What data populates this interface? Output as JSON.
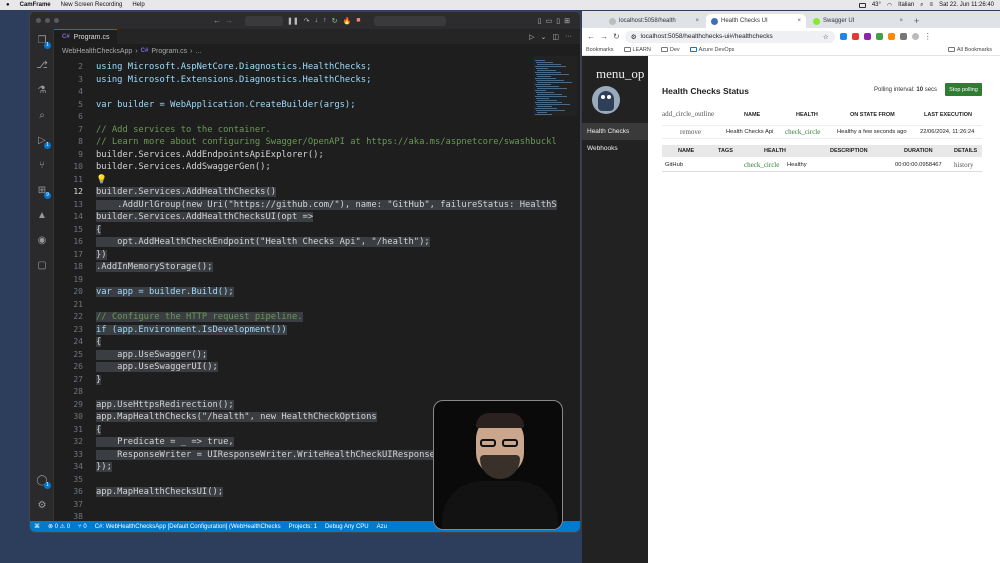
{
  "menubar": {
    "app": "CamFrame",
    "items": [
      "New Screen Recording",
      "Help"
    ],
    "temp": "43°",
    "input": "Italian",
    "datetime": "Sat 22. Jun 11:26:40"
  },
  "vscode": {
    "tab": {
      "label": "Program.cs",
      "badge": "C#"
    },
    "breadcrumb": [
      "WebHealthChecksApp",
      "Program.cs",
      "..."
    ],
    "code_lines": [
      {
        "n": "2",
        "text": "using Microsoft.AspNetCore.Diagnostics.HealthChecks;",
        "sel": false
      },
      {
        "n": "3",
        "text": "using Microsoft.Extensions.Diagnostics.HealthChecks;",
        "sel": false
      },
      {
        "n": "4",
        "text": "",
        "sel": false
      },
      {
        "n": "5",
        "text": "var builder = WebApplication.CreateBuilder(args);",
        "sel": false
      },
      {
        "n": "6",
        "text": "",
        "sel": false
      },
      {
        "n": "7",
        "text": "// Add services to the container.",
        "sel": false
      },
      {
        "n": "8",
        "text": "// Learn more about configuring Swagger/OpenAPI at https://aka.ms/aspnetcore/swashbuckl",
        "sel": false
      },
      {
        "n": "9",
        "text": "builder.Services.AddEndpointsApiExplorer();",
        "sel": false
      },
      {
        "n": "10",
        "text": "builder.Services.AddSwaggerGen();",
        "sel": false
      },
      {
        "n": "11",
        "text": "💡",
        "sel": false
      },
      {
        "n": "12",
        "text": "builder.Services.AddHealthChecks()",
        "sel": true
      },
      {
        "n": "13",
        "text": "    .AddUrlGroup(new Uri(\"https://github.com/\"), name: \"GitHub\", failureStatus: HealthS",
        "sel": true
      },
      {
        "n": "14",
        "text": "builder.Services.AddHealthChecksUI(opt =>",
        "sel": true
      },
      {
        "n": "15",
        "text": "{",
        "sel": true
      },
      {
        "n": "16",
        "text": "    opt.AddHealthCheckEndpoint(\"Health Checks Api\", \"/health\");",
        "sel": true
      },
      {
        "n": "17",
        "text": "})",
        "sel": true
      },
      {
        "n": "18",
        "text": ".AddInMemoryStorage();",
        "sel": true
      },
      {
        "n": "19",
        "text": "",
        "sel": false
      },
      {
        "n": "20",
        "text": "var app = builder.Build();",
        "sel": true
      },
      {
        "n": "21",
        "text": "",
        "sel": false
      },
      {
        "n": "22",
        "text": "// Configure the HTTP request pipeline.",
        "sel": true
      },
      {
        "n": "23",
        "text": "if (app.Environment.IsDevelopment())",
        "sel": true
      },
      {
        "n": "24",
        "text": "{",
        "sel": true
      },
      {
        "n": "25",
        "text": "    app.UseSwagger();",
        "sel": true
      },
      {
        "n": "26",
        "text": "    app.UseSwaggerUI();",
        "sel": true
      },
      {
        "n": "27",
        "text": "}",
        "sel": true
      },
      {
        "n": "28",
        "text": "",
        "sel": false
      },
      {
        "n": "29",
        "text": "app.UseHttpsRedirection();",
        "sel": true
      },
      {
        "n": "30",
        "text": "app.MapHealthChecks(\"/health\", new HealthCheckOptions",
        "sel": true
      },
      {
        "n": "31",
        "text": "{",
        "sel": true
      },
      {
        "n": "32",
        "text": "    Predicate = _ => true,",
        "sel": true
      },
      {
        "n": "33",
        "text": "    ResponseWriter = UIResponseWriter.WriteHealthCheckUIResponse",
        "sel": true
      },
      {
        "n": "34",
        "text": "});",
        "sel": true
      },
      {
        "n": "35",
        "text": "",
        "sel": false
      },
      {
        "n": "36",
        "text": "app.MapHealthChecksUI();",
        "sel": true
      },
      {
        "n": "37",
        "text": "",
        "sel": false
      },
      {
        "n": "38",
        "text": "",
        "sel": false
      }
    ],
    "current_line": "12",
    "status": {
      "remote": "⌘",
      "problems": "⊗ 0 ⚠ 0",
      "ports": "⑂ 0",
      "project": "C#: WebHealthChecksApp [Default Configuration] (WebHealthChecks",
      "projects": "Projects: 1",
      "config": "Debug Any CPU",
      "extra": "Azu"
    }
  },
  "browser": {
    "tabs": [
      {
        "label": "localhost:5058/health",
        "active": false,
        "fav": "gray"
      },
      {
        "label": "Health Checks UI",
        "active": true,
        "fav": "blue"
      },
      {
        "label": "Swagger UI",
        "active": false,
        "fav": "green"
      }
    ],
    "url": "localhost:5058/healthchecks-ui#/healthchecks",
    "bookmarks": [
      "Bookmarks",
      "LEARN",
      "Dev",
      "Azure DevOps"
    ],
    "all_bookmarks": "All Bookmarks"
  },
  "hc": {
    "menu": "menu_op",
    "nav": [
      "Health Checks",
      "Webhooks"
    ],
    "title": "Health Checks Status",
    "polling_label": "Polling interval:",
    "polling_value": "10",
    "polling_unit": "secs",
    "stop_button": "Stop polling",
    "table1": {
      "icon": "add_circle_outline",
      "headers": [
        "NAME",
        "HEALTH",
        "ON STATE FROM",
        "LAST EXECUTION"
      ],
      "row": {
        "icon": "remove",
        "name": "Health Checks Api",
        "health_icon": "check_circle",
        "state_from": "Healthy a few seconds ago",
        "last_exec": "22/06/2024, 11:26:24"
      }
    },
    "table2": {
      "headers": [
        "NAME",
        "TAGS",
        "HEALTH",
        "DESCRIPTION",
        "DURATION",
        "DETAILS"
      ],
      "row": {
        "name": "GitHub",
        "tags": "",
        "health_icon": "check_circle",
        "health": "Healthy",
        "description": "",
        "duration": "00:00:00.0958467",
        "details": "history"
      }
    }
  },
  "colors": {
    "accent": "#0078d4",
    "status_bar": "#007acc",
    "healthy": "#2e7d32"
  }
}
